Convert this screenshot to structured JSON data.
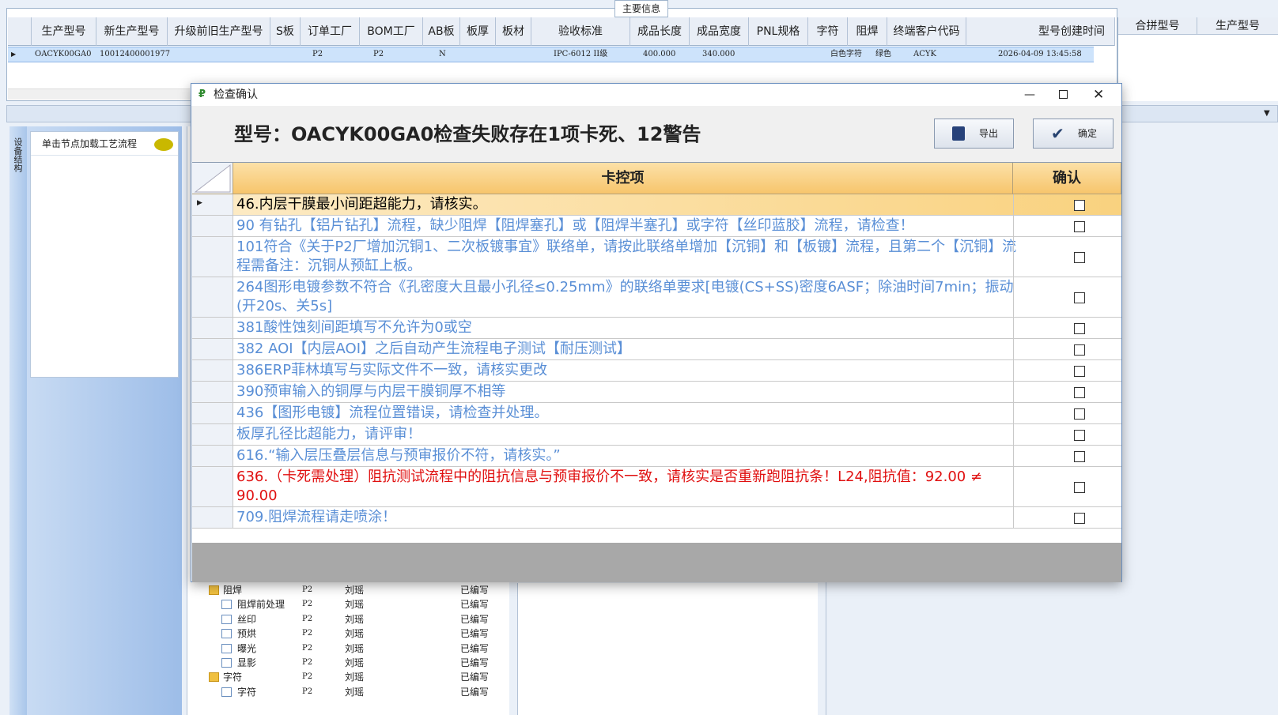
{
  "main_group": {
    "title": "主要信息",
    "columns": [
      "生产型号",
      "新生产型号",
      "升级前旧生产型号",
      "S板",
      "订单工厂",
      "BOM工厂",
      "AB板",
      "板厚",
      "板材",
      "验收标准",
      "成品长度",
      "成品宽度",
      "PNL规格",
      "字符",
      "阻焊",
      "终端客户代码",
      "型号创建时间"
    ],
    "row": {
      "model": "OACYK00GA0",
      "new_model": "10012400001977",
      "order_factory": "P2",
      "bom_factory": "P2",
      "ab_board": "N",
      "acceptance": "IPC-6012 II级",
      "length": "400.000",
      "width": "340.000",
      "char": "白色字符",
      "solder": "绿色",
      "customer": "ACYK",
      "created": "2026-04-09 13:45:58"
    },
    "right_columns": [
      "合拼型号",
      "生产型号"
    ]
  },
  "side": {
    "tab_label": "设备结构",
    "node_hint": "单击节点加载工艺流程"
  },
  "tree": {
    "rows": [
      {
        "name": "阻焊",
        "factory": "P2",
        "user": "刘瑶",
        "status": "已编写",
        "folder": true
      },
      {
        "name": "阻焊前处理",
        "factory": "P2",
        "user": "刘瑶",
        "status": "已编写",
        "folder": false
      },
      {
        "name": "丝印",
        "factory": "P2",
        "user": "刘瑶",
        "status": "已编写",
        "folder": false
      },
      {
        "name": "预烘",
        "factory": "P2",
        "user": "刘瑶",
        "status": "已编写",
        "folder": false
      },
      {
        "name": "曝光",
        "factory": "P2",
        "user": "刘瑶",
        "status": "已编写",
        "folder": false
      },
      {
        "name": "显影",
        "factory": "P2",
        "user": "刘瑶",
        "status": "已编写",
        "folder": false
      },
      {
        "name": "字符",
        "factory": "P2",
        "user": "刘瑶",
        "status": "已编写",
        "folder": true
      },
      {
        "name": "字符",
        "factory": "P2",
        "user": "刘瑶",
        "status": "已编写",
        "folder": false
      }
    ]
  },
  "dialog": {
    "title": "检查确认",
    "heading": "型号：OACYK00GA0检查失败存在1项卡死、12警告",
    "export_label": "导出",
    "confirm_label": "确定",
    "col_item": "卡控项",
    "col_confirm": "确认",
    "rows": [
      {
        "text": "46.内层干膜最小间距超能力，请核实。",
        "color": "#000000"
      },
      {
        "text": "90 有钻孔【铝片钻孔】流程，缺少阻焊【阻焊塞孔】或【阻焊半塞孔】或字符【丝印蓝胶】流程，请检查！",
        "color": "#5a8fd6"
      },
      {
        "text": "101符合《关于P2厂增加沉铜1、二次板镀事宜》联络单，请按此联络单增加【沉铜】和【板镀】流程，且第二个【沉铜】流程需备注：沉铜从预缸上板。",
        "color": "#5a8fd6"
      },
      {
        "text": "264图形电镀参数不符合《孔密度大且最小孔径≤0.25mm》的联络单要求[电镀(CS+SS)密度6ASF；除油时间7min；振动(开20s、关5s]",
        "color": "#5a8fd6"
      },
      {
        "text": "381酸性蚀刻间距填写不允许为0或空",
        "color": "#5a8fd6"
      },
      {
        "text": "382 AOI【内层AOI】之后自动产生流程电子测试【耐压测试】",
        "color": "#5a8fd6"
      },
      {
        "text": "386ERP菲林填写与实际文件不一致，请核实更改",
        "color": "#5a8fd6"
      },
      {
        "text": "390预审输入的铜厚与内层干膜铜厚不相等",
        "color": "#5a8fd6"
      },
      {
        "text": "436【图形电镀】流程位置错误，请检查并处理。",
        "color": "#5a8fd6"
      },
      {
        "text": "板厚孔径比超能力，请评审！",
        "color": "#5a8fd6"
      },
      {
        "text": "616.“输入层压叠层信息与预审报价不符，请核实。”",
        "color": "#5a8fd6"
      },
      {
        "text": "636.（卡死需处理）阻抗测试流程中的阻抗信息与预审报价不一致，请核实是否重新跑阻抗条！L24,阻抗值：92.00 ≠ 90.00",
        "color": "#e01010"
      },
      {
        "text": "709.阻焊流程请走喷涂！",
        "color": "#5a8fd6"
      }
    ]
  }
}
